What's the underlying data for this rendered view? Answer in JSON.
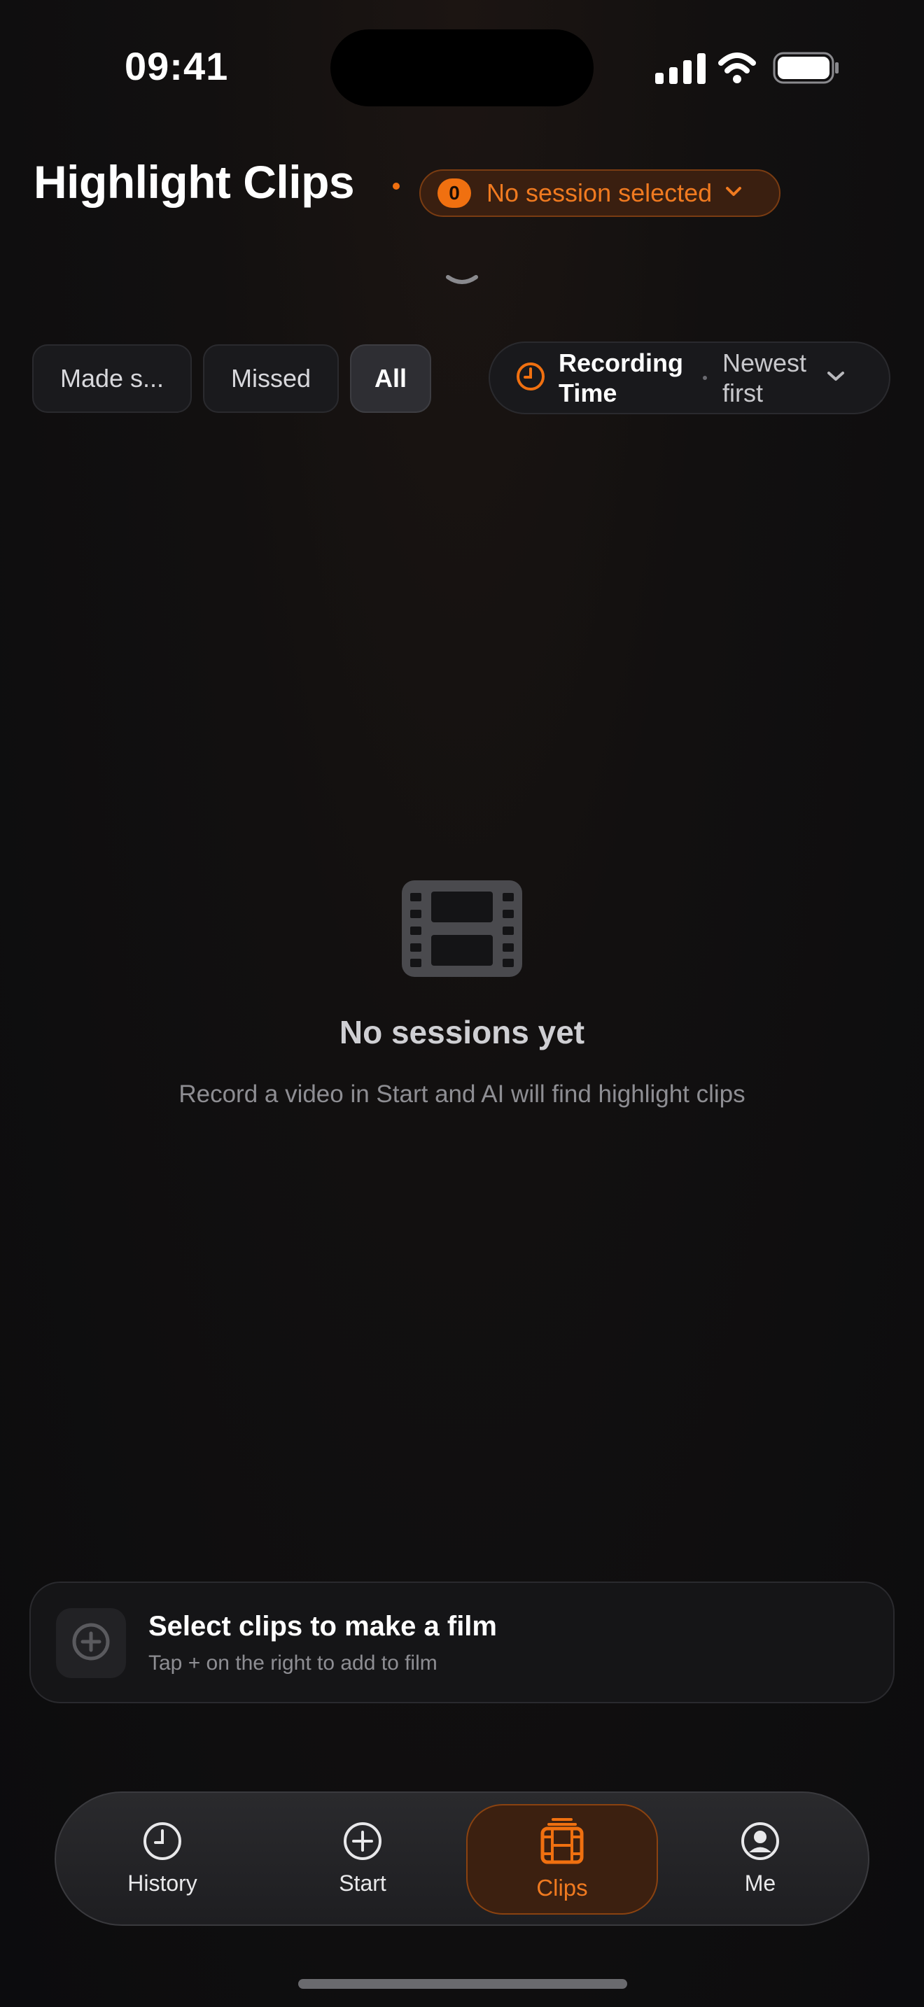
{
  "status_bar": {
    "time": "09:41"
  },
  "header": {
    "title": "Highlight Clips",
    "session_count": "0",
    "session_label": "No session selected"
  },
  "filters": {
    "segments": [
      {
        "label": "Made s..."
      },
      {
        "label": "Missed"
      },
      {
        "label": "All",
        "active": true
      }
    ],
    "sort": {
      "field": "Recording Time",
      "order": "Newest first"
    }
  },
  "empty_state": {
    "icon": "film-icon",
    "title": "No sessions yet",
    "subtitle": "Record a video in Start and AI will find highlight clips"
  },
  "film_card": {
    "title": "Select clips to make a film",
    "subtitle": "Tap + on the right to add to film"
  },
  "tab_bar": {
    "tabs": [
      {
        "label": "History",
        "icon": "clock-icon"
      },
      {
        "label": "Start",
        "icon": "plus-circle-icon"
      },
      {
        "label": "Clips",
        "icon": "film-icon",
        "active": true
      },
      {
        "label": "Me",
        "icon": "person-icon"
      }
    ]
  },
  "colors": {
    "accent": "#f07010",
    "background": "#0c0c0e"
  }
}
